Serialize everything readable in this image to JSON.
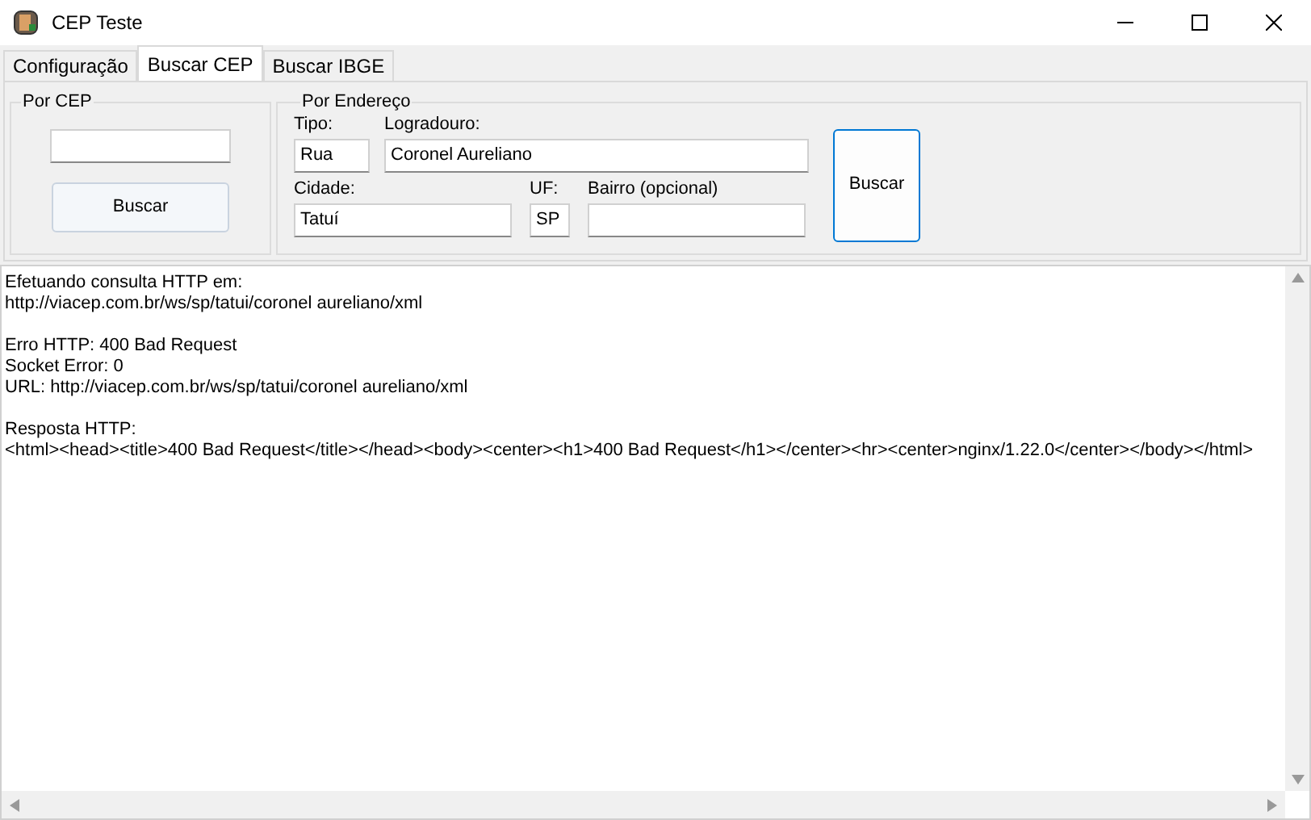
{
  "window": {
    "title": "CEP Teste"
  },
  "tabs": [
    {
      "label": "Configuração",
      "selected": false
    },
    {
      "label": "Buscar CEP",
      "selected": true
    },
    {
      "label": "Buscar IBGE",
      "selected": false
    }
  ],
  "por_cep": {
    "title": "Por CEP",
    "button": "Buscar"
  },
  "por_endereco": {
    "title": "Por Endereço",
    "fields": [
      {
        "label": "Tipo:",
        "value": "Rua"
      },
      {
        "label": "Logradouro:",
        "value": "Coronel Aureliano"
      },
      {
        "label": "Cidade:",
        "value": "Tatuí"
      },
      {
        "label": "UF:",
        "value": "SP"
      },
      {
        "label": "Bairro (opcional)"
      }
    ],
    "button": "Buscar"
  },
  "output": [
    [
      "Efetuando consulta HTTP em:",
      "http://viacep.com.br/ws/sp/tatui/coronel aureliano/xml"
    ],
    [
      "Erro HTTP: 400 Bad Request",
      "Socket Error: 0",
      "URL: http://viacep.com.br/ws/sp/tatui/coronel aureliano/xml"
    ],
    [
      "Resposta HTTP:",
      "<html><head><title>400 Bad Request</title></head><body><center><h1>400 Bad Request</h1></center><hr><center>nginx/1.22.0</center></body></html>"
    ]
  ]
}
